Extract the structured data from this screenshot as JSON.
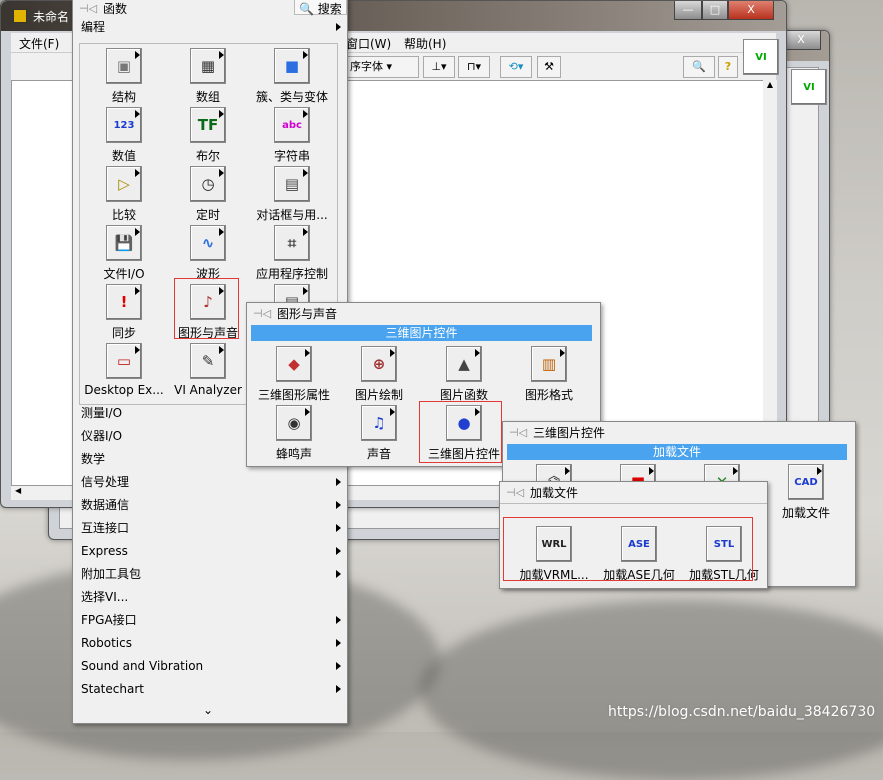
{
  "window": {
    "title": "未命名",
    "menus": [
      "文件(F)",
      "窗口(W)",
      "帮助(H)"
    ],
    "font_select": "序字体",
    "minimize": "—",
    "maximize": "□",
    "close": "X"
  },
  "functions_palette": {
    "title": "函数",
    "search": "搜索",
    "category": "编程",
    "grid": [
      {
        "label": "结构",
        "glyph": "▣",
        "color": "#777"
      },
      {
        "label": "数组",
        "glyph": "▦",
        "color": "#333"
      },
      {
        "label": "簇、类与变体",
        "glyph": "■",
        "color": "#2a6ee0"
      },
      {
        "label": "数值",
        "glyph": "123",
        "color": "#1a3bd0"
      },
      {
        "label": "布尔",
        "glyph": "TF",
        "color": "#0a6a1a"
      },
      {
        "label": "字符串",
        "glyph": "abc",
        "color": "#d000d0"
      },
      {
        "label": "比较",
        "glyph": "▷",
        "color": "#a88a00"
      },
      {
        "label": "定时",
        "glyph": "◷",
        "color": "#222"
      },
      {
        "label": "对话框与用...",
        "glyph": "▤",
        "color": "#444"
      },
      {
        "label": "文件I/O",
        "glyph": "💾",
        "color": "#1a3bd0"
      },
      {
        "label": "波形",
        "glyph": "∿",
        "color": "#2a6ee0"
      },
      {
        "label": "应用程序控制",
        "glyph": "⌗",
        "color": "#444"
      },
      {
        "label": "同步",
        "glyph": "!",
        "color": "#d00"
      },
      {
        "label": "图形与声音",
        "glyph": "♪",
        "color": "#b03030"
      },
      {
        "label": "报表生成",
        "glyph": "▤",
        "color": "#444"
      },
      {
        "label": "Desktop Ex...",
        "glyph": "▭",
        "color": "#c02020"
      },
      {
        "label": "VI Analyzer",
        "glyph": "✎",
        "color": "#333"
      }
    ],
    "items": [
      {
        "label": "测量I/O",
        "sub": false
      },
      {
        "label": "仪器I/O",
        "sub": false
      },
      {
        "label": "数学",
        "sub": false
      },
      {
        "label": "信号处理",
        "sub": true
      },
      {
        "label": "数据通信",
        "sub": true
      },
      {
        "label": "互连接口",
        "sub": true
      },
      {
        "label": "Express",
        "sub": true
      },
      {
        "label": "附加工具包",
        "sub": true
      },
      {
        "label": "选择VI...",
        "sub": false
      },
      {
        "label": "FPGA接口",
        "sub": true
      },
      {
        "label": "Robotics",
        "sub": true
      },
      {
        "label": "Sound and Vibration",
        "sub": true
      },
      {
        "label": "Statechart",
        "sub": true
      }
    ],
    "more": "⌄"
  },
  "graphics_palette": {
    "title": "图形与声音",
    "highlight": "三维图片控件",
    "grid": [
      {
        "label": "三维图形属性",
        "glyph": "◆",
        "color": "#c03030"
      },
      {
        "label": "图片绘制",
        "glyph": "⊕",
        "color": "#a03030"
      },
      {
        "label": "图片函数",
        "glyph": "▲",
        "color": "#444"
      },
      {
        "label": "图形格式",
        "glyph": "▥",
        "color": "#c06000"
      },
      {
        "label": "蜂鸣声",
        "glyph": "◉",
        "color": "#333"
      },
      {
        "label": "声音",
        "glyph": "♫",
        "color": "#1a3bd0"
      },
      {
        "label": "三维图片控件",
        "glyph": "●",
        "color": "#2040d0"
      }
    ]
  },
  "picture3d_palette": {
    "title": "三维图片控件",
    "highlight": "加载文件",
    "grid": [
      {
        "label": "",
        "glyph": "⌬",
        "color": "#333"
      },
      {
        "label": "",
        "glyph": "■",
        "color": "#d00"
      },
      {
        "label": "",
        "glyph": "✕",
        "color": "#2a8a2a"
      },
      {
        "label": "加载文件",
        "glyph": "CAD",
        "color": "#1a3bd0"
      }
    ]
  },
  "loadfile_palette": {
    "title": "加载文件",
    "grid": [
      {
        "label": "加载VRML...",
        "glyph": "WRL",
        "color": "#222"
      },
      {
        "label": "加载ASE几何",
        "glyph": "ASE",
        "color": "#1a3bd0"
      },
      {
        "label": "加载STL几何",
        "glyph": "STL",
        "color": "#1a3bd0"
      }
    ]
  },
  "watermark": "https://blog.csdn.net/baidu_38426730",
  "colors": {
    "highlight": "#4aa3ee",
    "selection_box": "#e53935"
  }
}
